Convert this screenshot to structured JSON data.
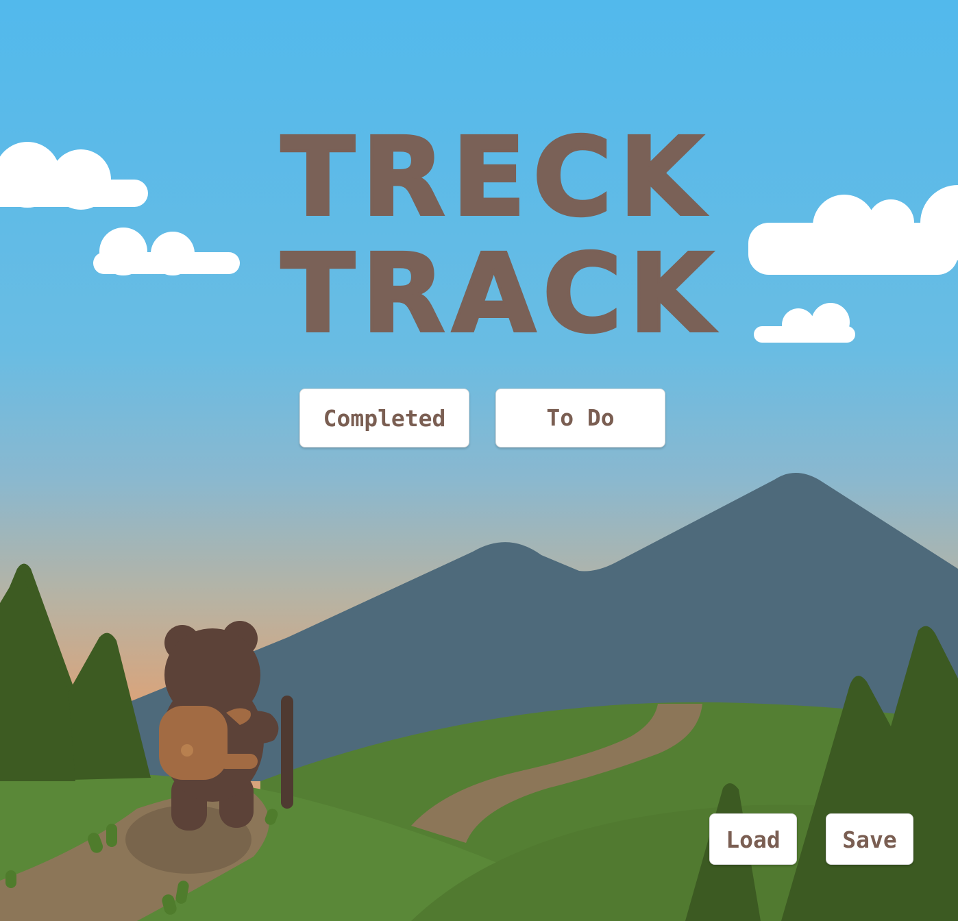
{
  "logo": {
    "line1": "TRECK",
    "line2": "TRACK"
  },
  "menu": {
    "completed_label": "Completed",
    "todo_label": "To Do"
  },
  "footer": {
    "load_label": "Load",
    "save_label": "Save"
  },
  "colors": {
    "sky_top": "#54baeb",
    "sky_horizon": "#d8a47c",
    "logo_brown": "#7a6157",
    "button_text": "#7a5e52",
    "mountain": "#4e6a7b",
    "hill_green": "#5a8236",
    "tree_dark": "#3c5a22",
    "path": "#8b7455",
    "bear": "#5c4238",
    "backpack": "#a26b43"
  },
  "icons": {
    "mascot": "hiking-bear-icon",
    "logo_mark": "mountain-peak-icon"
  }
}
